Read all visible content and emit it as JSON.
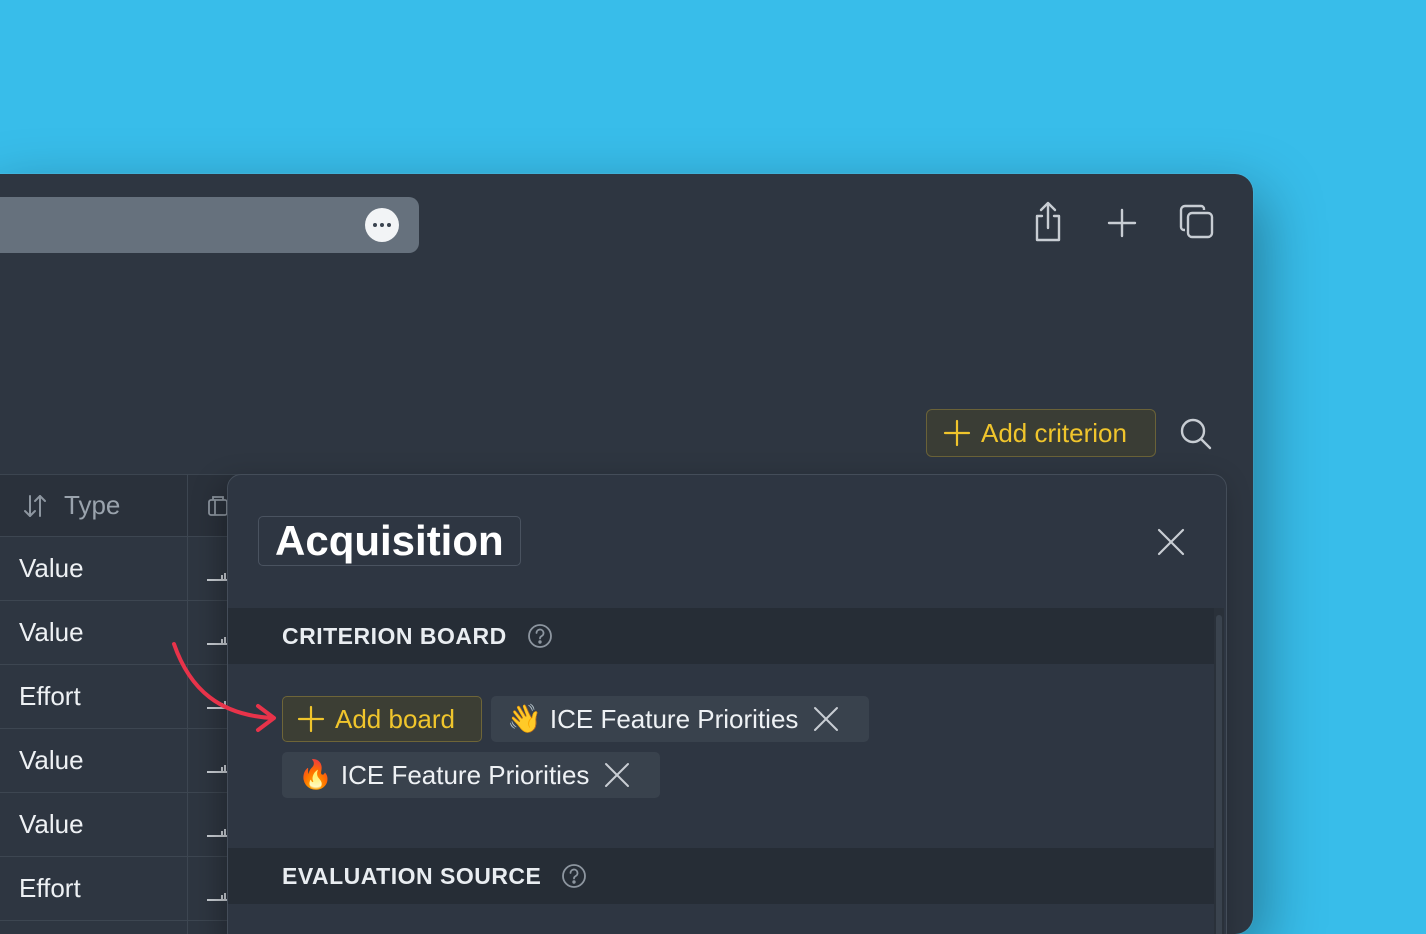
{
  "toolbar": {
    "more_icon": "ellipsis-icon",
    "share_icon": "share-icon",
    "new_tab_icon": "plus-icon",
    "tabs_icon": "tabs-icon"
  },
  "criteria": {
    "add_label": "Add criterion",
    "search_icon": "search-icon"
  },
  "table": {
    "header": "Type",
    "rows": [
      "Value",
      "Value",
      "Effort",
      "Value",
      "Value",
      "Effort"
    ]
  },
  "panel": {
    "title": "Acquisition",
    "sections": {
      "board": "CRITERION BOARD",
      "source": "EVALUATION SOURCE"
    },
    "add_board_label": "Add board",
    "boards": [
      {
        "emoji": "👋",
        "name": "ICE Feature Priorities"
      },
      {
        "emoji": "🔥",
        "name": "ICE Feature Priorities"
      }
    ]
  },
  "colors": {
    "background": "#38bdea",
    "window": "#2e3641",
    "accent": "#f0c52c",
    "annotation_arrow": "#e8334a"
  }
}
